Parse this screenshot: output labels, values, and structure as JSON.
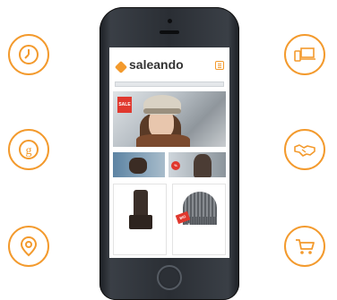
{
  "feature_icons": {
    "left": [
      "clock-icon",
      "google-icon",
      "location-pin-icon"
    ],
    "right": [
      "devices-icon",
      "handshake-icon",
      "shopping-cart-icon"
    ]
  },
  "colors": {
    "accent": "#f39a2d",
    "sale": "#e0382e",
    "phone_body": "#2a2e34",
    "text_dark": "#333333"
  },
  "app": {
    "brand": "saleando",
    "hero": {
      "badge": "SALE"
    },
    "thumbs": [
      {
        "badge": ""
      },
      {
        "badge": "%"
      }
    ],
    "products": [
      {
        "name": "",
        "sub": "",
        "price": ""
      },
      {
        "name": "",
        "sub": "",
        "price": "",
        "badge": "BIG SALE"
      }
    ]
  }
}
